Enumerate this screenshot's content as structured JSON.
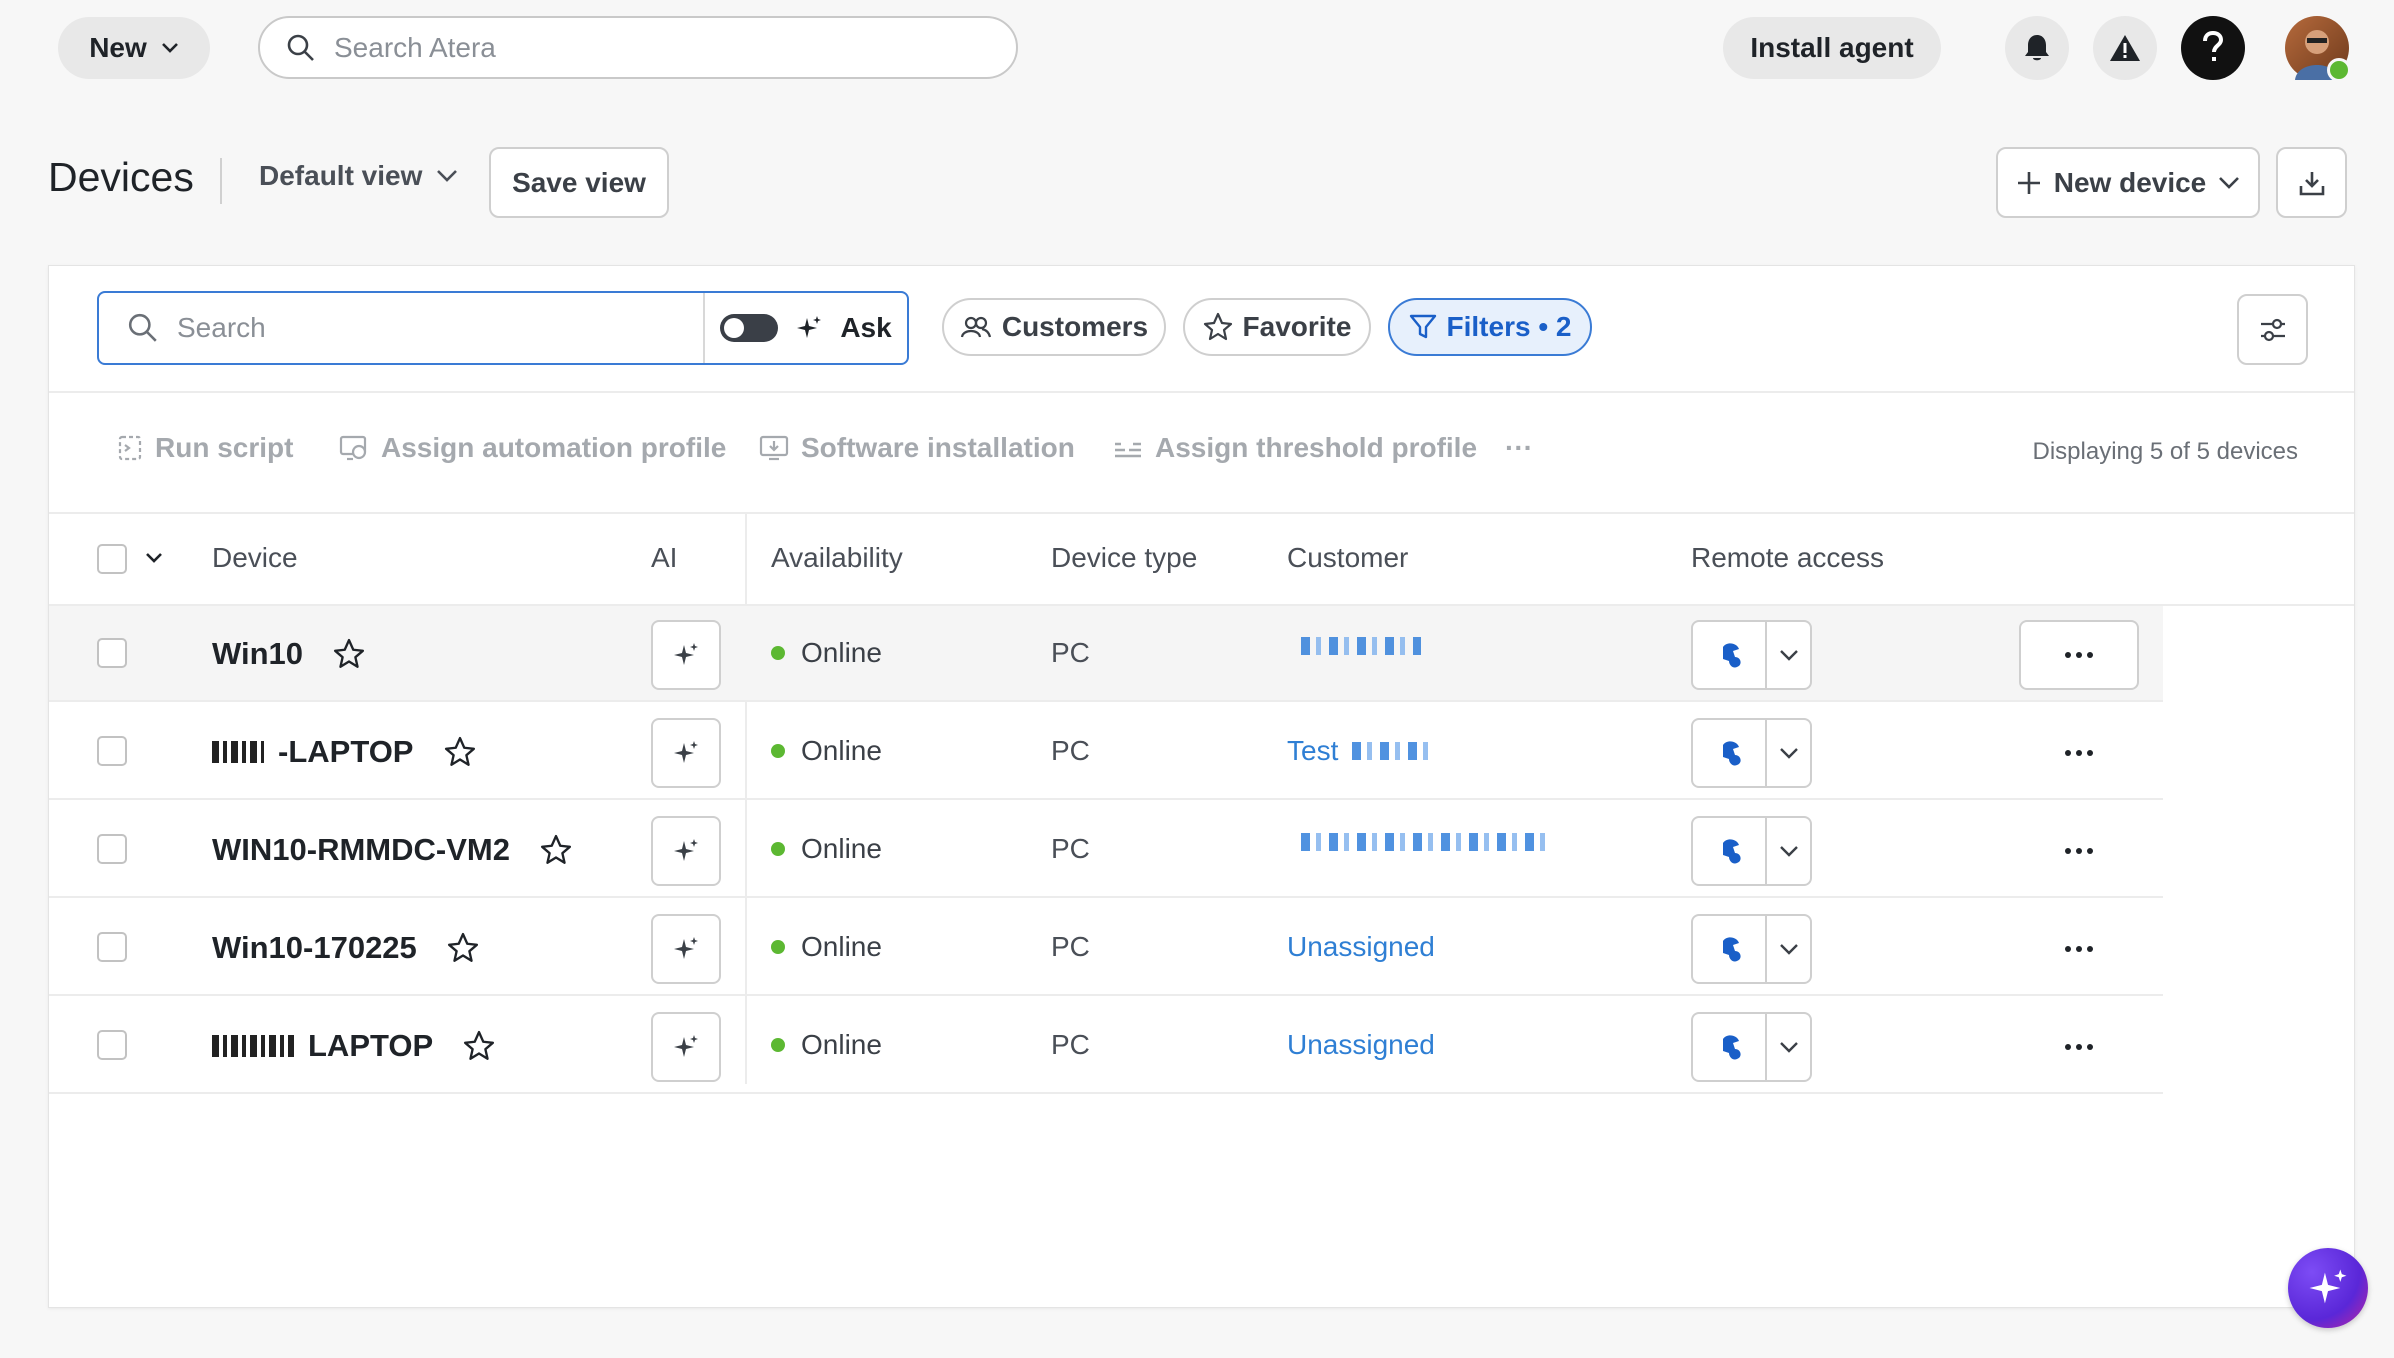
{
  "topbar": {
    "new_label": "New",
    "search_placeholder": "Search Atera",
    "install_agent_label": "Install agent"
  },
  "header": {
    "title": "Devices",
    "view_label": "Default view",
    "save_view_label": "Save view",
    "new_device_label": "New device"
  },
  "filters": {
    "search_placeholder": "Search",
    "ask_label": "Ask",
    "customers_label": "Customers",
    "favorite_label": "Favorite",
    "filters_label": "Filters • 2"
  },
  "actions": {
    "run_script": "Run script",
    "assign_automation": "Assign automation profile",
    "software_installation": "Software installation",
    "assign_threshold": "Assign threshold profile",
    "more": "···",
    "displaying": "Displaying 5 of 5 devices"
  },
  "table": {
    "columns": {
      "device": "Device",
      "ai": "AI",
      "availability": "Availability",
      "device_type": "Device type",
      "customer": "Customer",
      "remote_access": "Remote access"
    },
    "rows": [
      {
        "name": "Win10",
        "prefix_redacted": false,
        "availability": "Online",
        "type": "PC",
        "customer": "",
        "customer_redacted": true
      },
      {
        "name": "-LAPTOP",
        "prefix_redacted": true,
        "availability": "Online",
        "type": "PC",
        "customer": "Test",
        "customer_redacted": true
      },
      {
        "name": "WIN10-RMMDC-VM2",
        "prefix_redacted": false,
        "availability": "Online",
        "type": "PC",
        "customer": "",
        "customer_redacted": true
      },
      {
        "name": "Win10-170225",
        "prefix_redacted": false,
        "availability": "Online",
        "type": "PC",
        "customer": "Unassigned",
        "customer_redacted": false
      },
      {
        "name": "LAPTOP",
        "prefix_redacted": true,
        "availability": "Online",
        "type": "PC",
        "customer": "Unassigned",
        "customer_redacted": false
      }
    ]
  },
  "colors": {
    "accent": "#3a7bd5",
    "online": "#5cb832",
    "link": "#2f7fd4"
  }
}
